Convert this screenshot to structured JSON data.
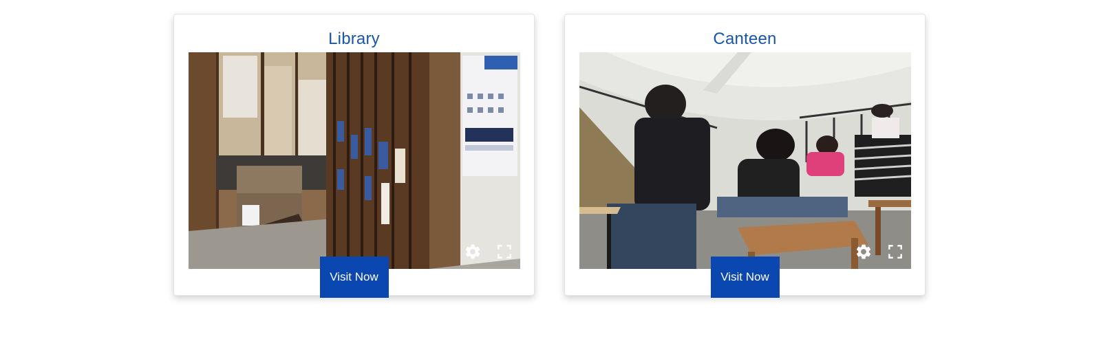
{
  "cards": [
    {
      "title": "Library",
      "button_label": "Visit Now",
      "controls": [
        "gear-icon",
        "fullscreen-icon"
      ]
    },
    {
      "title": "Canteen",
      "button_label": "Visit Now",
      "controls": [
        "gear-icon",
        "fullscreen-icon"
      ]
    }
  ],
  "colors": {
    "title": "#1a56a8",
    "button": "#0b47b0",
    "button_text": "#ffffff"
  }
}
